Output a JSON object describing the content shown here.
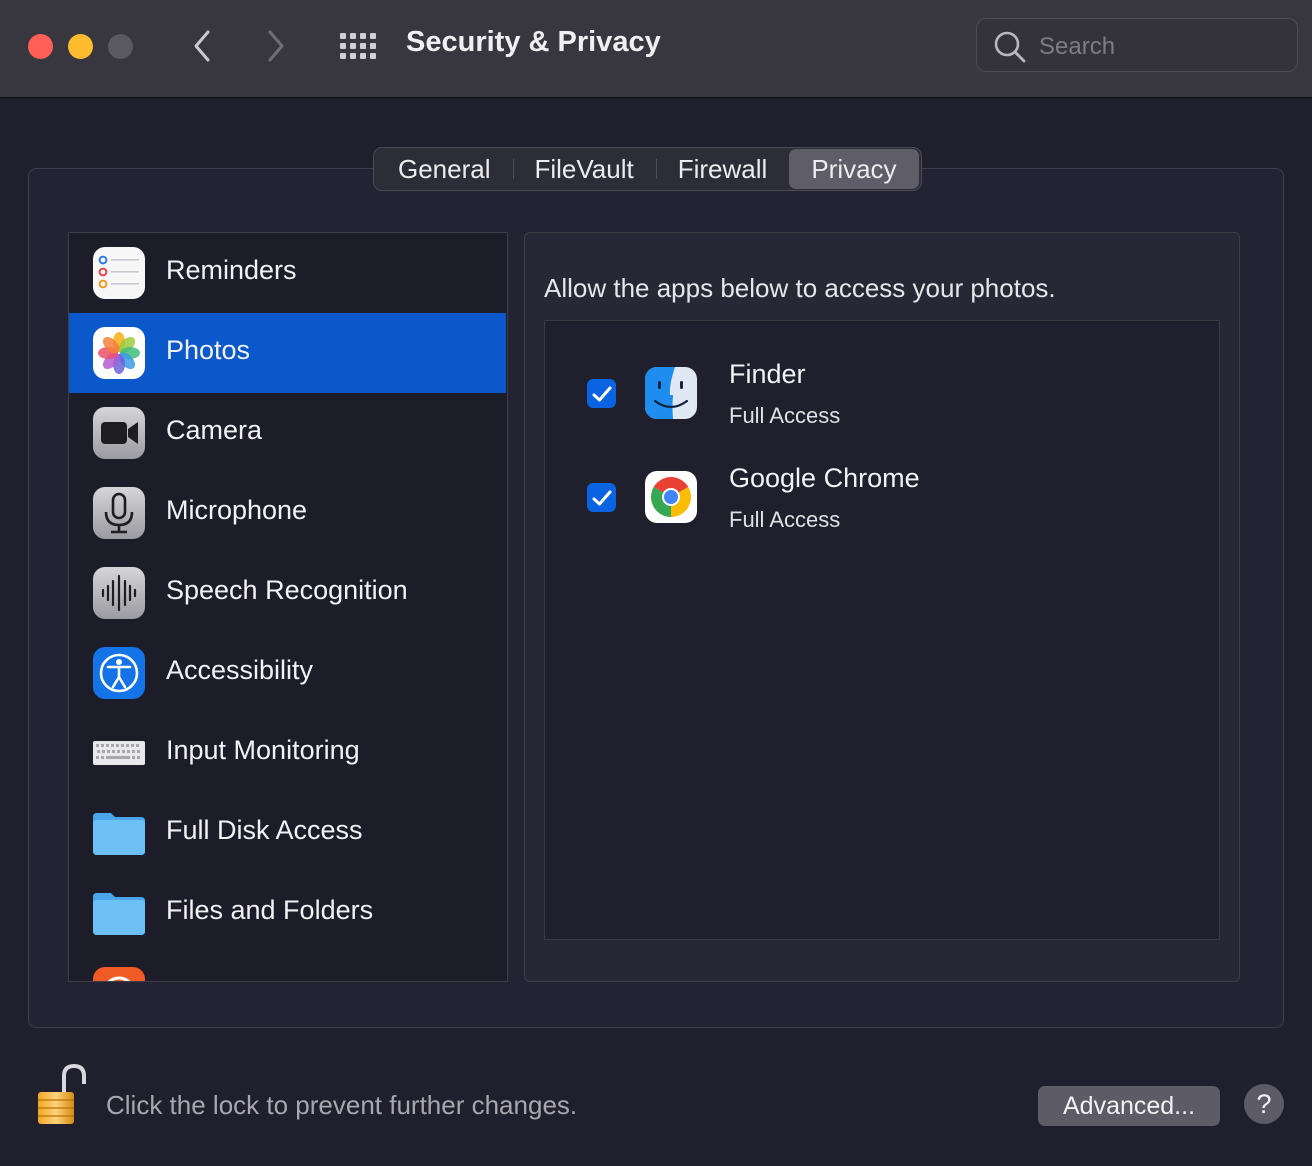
{
  "window": {
    "title": "Security & Privacy",
    "search_placeholder": "Search"
  },
  "tabs": [
    {
      "label": "General",
      "active": false
    },
    {
      "label": "FileVault",
      "active": false
    },
    {
      "label": "Firewall",
      "active": false
    },
    {
      "label": "Privacy",
      "active": true
    }
  ],
  "sidebar": {
    "selected": "Photos",
    "items": [
      {
        "label": "Reminders",
        "icon": "reminders-icon"
      },
      {
        "label": "Photos",
        "icon": "photos-icon"
      },
      {
        "label": "Camera",
        "icon": "camera-icon"
      },
      {
        "label": "Microphone",
        "icon": "microphone-icon"
      },
      {
        "label": "Speech Recognition",
        "icon": "speech-recognition-icon"
      },
      {
        "label": "Accessibility",
        "icon": "accessibility-icon"
      },
      {
        "label": "Input Monitoring",
        "icon": "keyboard-icon"
      },
      {
        "label": "Full Disk Access",
        "icon": "folder-icon"
      },
      {
        "label": "Files and Folders",
        "icon": "folder-icon"
      }
    ]
  },
  "content": {
    "description": "Allow the apps below to access your photos.",
    "apps": [
      {
        "name": "Finder",
        "access": "Full Access",
        "checked": true,
        "icon": "finder-icon"
      },
      {
        "name": "Google Chrome",
        "access": "Full Access",
        "checked": true,
        "icon": "chrome-icon"
      }
    ]
  },
  "footer": {
    "lock_message": "Click the lock to prevent further changes.",
    "advanced_label": "Advanced...",
    "help_label": "?"
  },
  "colors": {
    "selection": "#0a58ca",
    "checkbox": "#0a63e0",
    "close": "#fe5f57",
    "minimize": "#febc2e"
  }
}
